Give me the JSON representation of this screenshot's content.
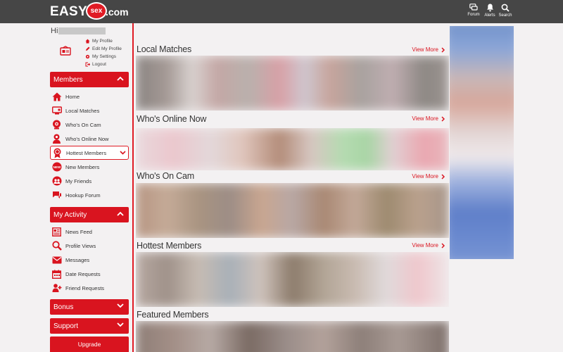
{
  "header": {
    "logo": {
      "easy": "EASY",
      "sex": "sex",
      "dotcom": ".com"
    },
    "nav": [
      {
        "label": "Forum",
        "icon": "chat-icon"
      },
      {
        "label": "Alerts",
        "icon": "bell-icon"
      },
      {
        "label": "Search",
        "icon": "search-icon"
      }
    ]
  },
  "sidebar": {
    "greeting": "Hi",
    "profile_links": [
      {
        "label": "My Profile",
        "icon": "home-icon"
      },
      {
        "label": "Edit My Profile",
        "icon": "pencil-icon"
      },
      {
        "label": "My Settings",
        "icon": "gear-icon"
      },
      {
        "label": "Logout",
        "icon": "logout-icon"
      }
    ],
    "sections": {
      "members": "Members",
      "my_activity": "My Activity",
      "bonus": "Bonus",
      "support": "Support"
    },
    "members_items": [
      {
        "label": "Home",
        "icon": "home-icon"
      },
      {
        "label": "Local Matches",
        "icon": "map-icon"
      },
      {
        "label": "Who's On Cam",
        "icon": "webcam-icon"
      },
      {
        "label": "Who's Online Now",
        "icon": "user-online-icon"
      },
      {
        "label": "Hottest Members",
        "icon": "award-icon"
      },
      {
        "label": "New Members",
        "icon": "new-badge-icon"
      },
      {
        "label": "My Friends",
        "icon": "friends-icon"
      },
      {
        "label": "Hookup Forum",
        "icon": "forum-icon"
      }
    ],
    "activity_items": [
      {
        "label": "News Feed",
        "icon": "news-icon"
      },
      {
        "label": "Profile Views",
        "icon": "magnifier-icon"
      },
      {
        "label": "Messages",
        "icon": "envelope-icon"
      },
      {
        "label": "Date Requests",
        "icon": "calendar-icon"
      },
      {
        "label": "Friend Requests",
        "icon": "friend-request-icon"
      }
    ],
    "upgrade": "Upgrade"
  },
  "main": {
    "view_more": "View More",
    "sections": [
      {
        "title": "Local Matches"
      },
      {
        "title": "Who's Online Now"
      },
      {
        "title": "Who's On Cam"
      },
      {
        "title": "Hottest Members"
      },
      {
        "title": "Featured Members"
      }
    ]
  },
  "colors": {
    "accent": "#d9141f",
    "topbar": "#464646",
    "background": "#f3f1f2"
  }
}
